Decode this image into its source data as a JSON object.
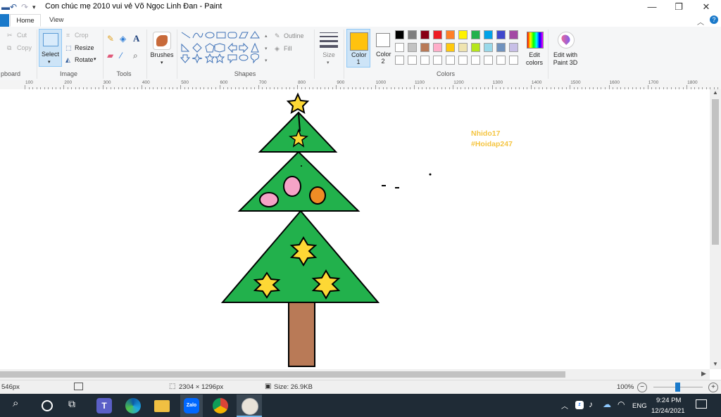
{
  "window": {
    "title": "Con chúc mẹ 2010 vui vẻ Võ Ngọc Linh Đan - Paint",
    "minimize_label": "—",
    "restore_label": "❐",
    "close_label": "✕"
  },
  "tabs": {
    "home": "Home",
    "view": "View"
  },
  "ribbon": {
    "clipboard": {
      "cut": "Cut",
      "copy": "Copy",
      "group_label": "pboard"
    },
    "image": {
      "select": "Select",
      "crop": "Crop",
      "resize": "Resize",
      "rotate": "Rotate",
      "group_label": "Image"
    },
    "tools": {
      "group_label": "Tools"
    },
    "brushes": {
      "label": "Brushes"
    },
    "shapes": {
      "outline": "Outline",
      "fill": "Fill",
      "group_label": "Shapes"
    },
    "size": {
      "label": "Size"
    },
    "color1": {
      "label": "Color 1",
      "value": "#ffc20e"
    },
    "color2": {
      "label": "Color 2",
      "value": "#ffffff"
    },
    "colors": {
      "group_label": "Colors",
      "row1": [
        "#000000",
        "#7f7f7f",
        "#880015",
        "#ed1c24",
        "#ff7f27",
        "#fff200",
        "#22b14c",
        "#00a2e8",
        "#3f48cc",
        "#a349a4"
      ],
      "row2": [
        "#ffffff",
        "#c3c3c3",
        "#b97a57",
        "#ffaec9",
        "#ffc90e",
        "#efe4b0",
        "#b5e61d",
        "#99d9ea",
        "#7092be",
        "#c8bfe7"
      ],
      "row3": [
        "#ffffff",
        "#ffffff",
        "#ffffff",
        "#ffffff",
        "#ffffff",
        "#ffffff",
        "#ffffff",
        "#ffffff",
        "#ffffff",
        "#ffffff"
      ]
    },
    "edit_colors": "Edit colors",
    "edit_3d": "Edit with Paint 3D"
  },
  "ruler": {
    "ticks": [
      "100",
      "200",
      "300",
      "400",
      "500",
      "600",
      "700",
      "800",
      "900",
      "1000",
      "1100",
      "1200",
      "1300",
      "1400",
      "1500",
      "1600",
      "1700",
      "1800"
    ]
  },
  "canvas": {
    "text_line1": "Nhido17",
    "text_line2": "#Hoidap247",
    "text_color": "#f5c542",
    "tree_green": "#22b14c",
    "trunk_color": "#b97a57",
    "star_color": "#fdd835",
    "ornament_pink": "#f5a3c7",
    "ornament_orange": "#f08c25"
  },
  "status": {
    "cursor": "546px",
    "dimensions": "2304 × 1296px",
    "size": "Size: 26.9KB",
    "zoom": "100%"
  },
  "taskbar": {
    "lang": "ENG",
    "time": "9:24 PM",
    "date": "12/24/2021"
  }
}
